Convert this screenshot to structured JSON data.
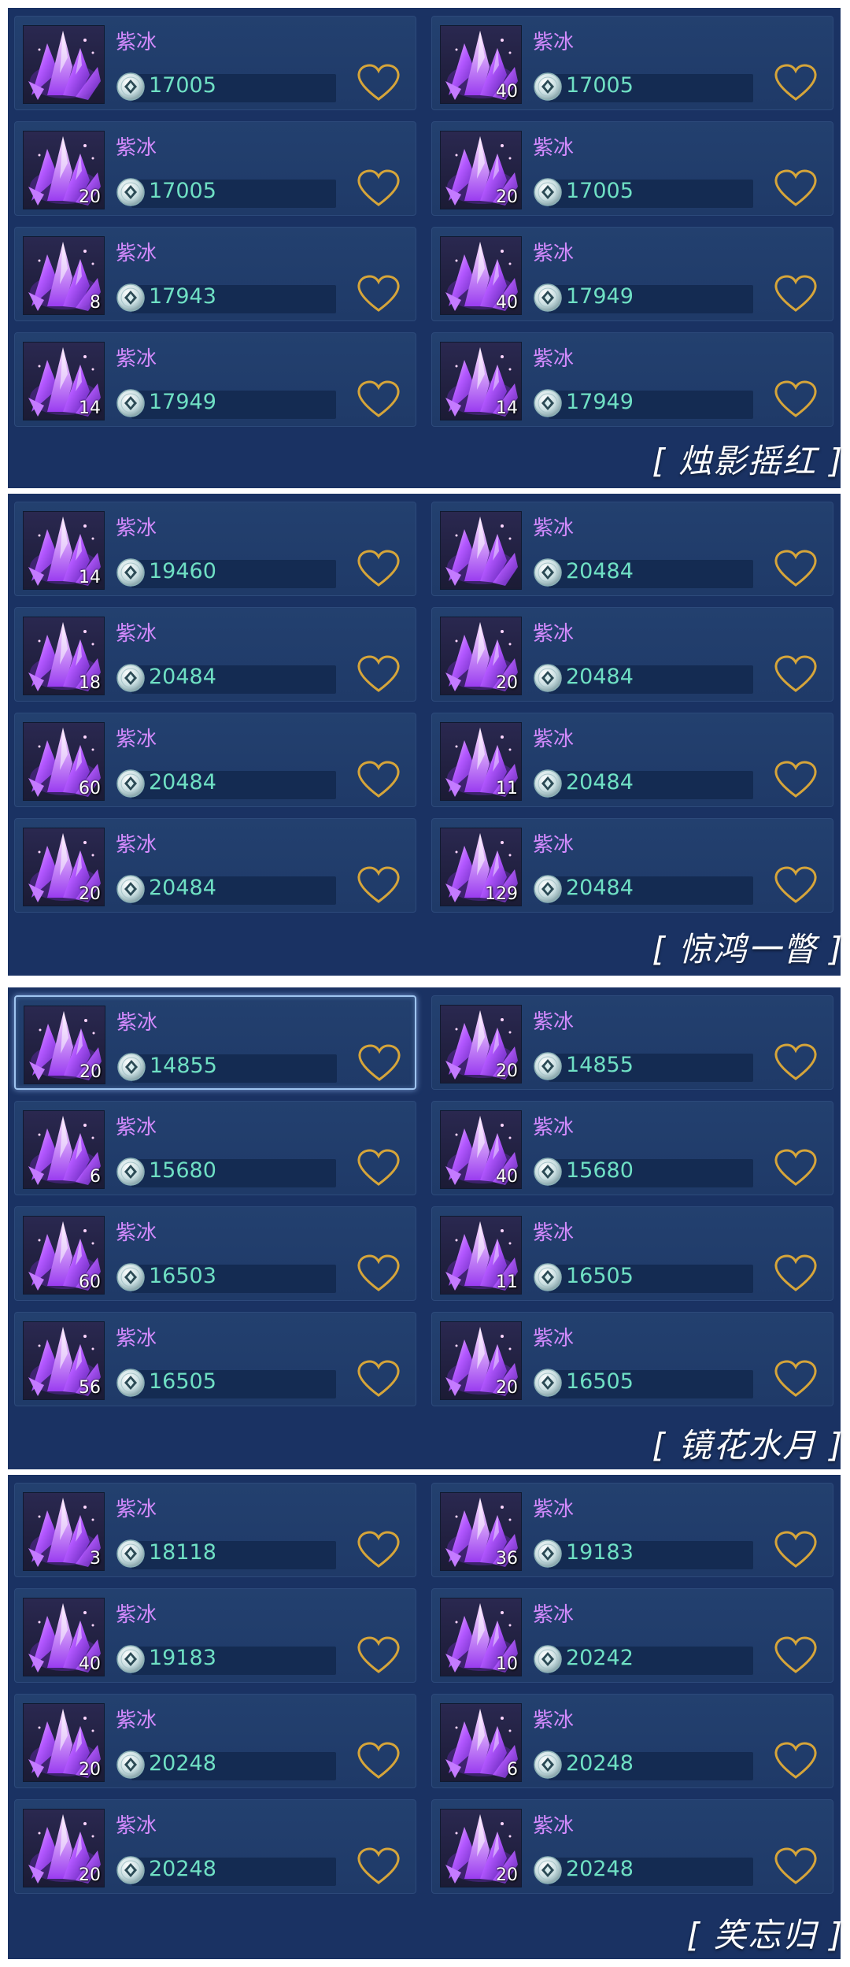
{
  "item_name": "紫冰",
  "sections": [
    {
      "title": "[ 烛影摇红 ]",
      "items": [
        {
          "qty": "",
          "price": "17005"
        },
        {
          "qty": "40",
          "price": "17005"
        },
        {
          "qty": "20",
          "price": "17005"
        },
        {
          "qty": "20",
          "price": "17005"
        },
        {
          "qty": "8",
          "price": "17943"
        },
        {
          "qty": "40",
          "price": "17949"
        },
        {
          "qty": "14",
          "price": "17949"
        },
        {
          "qty": "14",
          "price": "17949"
        }
      ]
    },
    {
      "title": "[ 惊鸿一瞥 ]",
      "items": [
        {
          "qty": "14",
          "price": "19460"
        },
        {
          "qty": "",
          "price": "20484"
        },
        {
          "qty": "18",
          "price": "20484"
        },
        {
          "qty": "20",
          "price": "20484"
        },
        {
          "qty": "60",
          "price": "20484"
        },
        {
          "qty": "11",
          "price": "20484"
        },
        {
          "qty": "20",
          "price": "20484"
        },
        {
          "qty": "129",
          "price": "20484"
        }
      ]
    },
    {
      "title": "[ 镜花水月 ]",
      "items": [
        {
          "qty": "20",
          "price": "14855",
          "selected": true
        },
        {
          "qty": "20",
          "price": "14855"
        },
        {
          "qty": "6",
          "price": "15680"
        },
        {
          "qty": "40",
          "price": "15680"
        },
        {
          "qty": "60",
          "price": "16503"
        },
        {
          "qty": "11",
          "price": "16505"
        },
        {
          "qty": "56",
          "price": "16505"
        },
        {
          "qty": "20",
          "price": "16505"
        }
      ]
    },
    {
      "title": "[ 笑忘归 ]",
      "items": [
        {
          "qty": "3",
          "price": "18118"
        },
        {
          "qty": "36",
          "price": "19183"
        },
        {
          "qty": "40",
          "price": "19183"
        },
        {
          "qty": "10",
          "price": "20242"
        },
        {
          "qty": "20",
          "price": "20248"
        },
        {
          "qty": "6",
          "price": "20248"
        },
        {
          "qty": "20",
          "price": "20248"
        },
        {
          "qty": "20",
          "price": "20248"
        }
      ]
    }
  ],
  "icons": {
    "item": "purple-ice-crystal-icon",
    "currency": "silver-coin-icon",
    "favorite": "heart-outline-icon"
  },
  "colors": {
    "panel_bg": "#1a3263",
    "card_bg": "#23406f",
    "name": "#d48bff",
    "price": "#6fe0c4",
    "heart": "#d6a53a"
  }
}
